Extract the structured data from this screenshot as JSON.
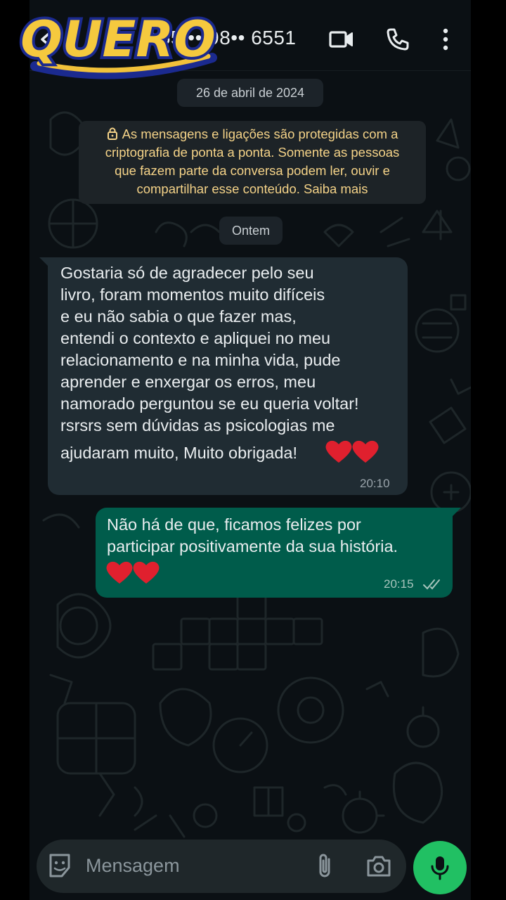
{
  "watermark": {
    "logo_text": "QUERO"
  },
  "header": {
    "contact_name": "+55 •• 98•• 6551",
    "icons": [
      "back-arrow-icon",
      "video-call-icon",
      "voice-call-icon",
      "more-options-icon"
    ]
  },
  "chat": {
    "date_separator_1": "26 de abril de 2024",
    "encryption_notice": {
      "line1": "As mensagens e ligações são protegidas com a",
      "line2": "criptografia de ponta a ponta. Somente as pessoas",
      "line3": "que fazem parte da conversa podem ler, ouvir e",
      "line4": "compartilhar esse conteúdo. Saiba mais"
    },
    "date_separator_2": "Ontem",
    "incoming": {
      "lines": [
        "Gostaria só de agradecer pelo seu",
        "livro, foram momentos muito difíceis",
        "e eu não sabia o que fazer mas,",
        "entendi o contexto e apliquei no meu",
        "relacionamento e na minha vida, pude",
        "aprender e enxergar os erros, meu",
        "namorado perguntou se eu queria voltar!",
        "rsrsrs sem dúvidas as psicologias me",
        "ajudaram muito, Muito obrigada!"
      ],
      "emoji": "❤️❤️",
      "time": "20:10"
    },
    "outgoing": {
      "lines": [
        "Não há de que, ficamos felizes por",
        "participar positivamente da sua história."
      ],
      "emoji": "❤️❤️",
      "time": "20:15",
      "status": "read"
    }
  },
  "composer": {
    "placeholder": "Mensagem",
    "icons": [
      "emoji-sticker-icon",
      "attach-clip-icon",
      "camera-icon",
      "microphone-icon"
    ],
    "mic_color": "#21c063"
  },
  "colors": {
    "background": "#0b1014",
    "incoming_bubble": "#202c33",
    "outgoing_bubble": "#005c4b",
    "notice_text": "#f5d388"
  }
}
